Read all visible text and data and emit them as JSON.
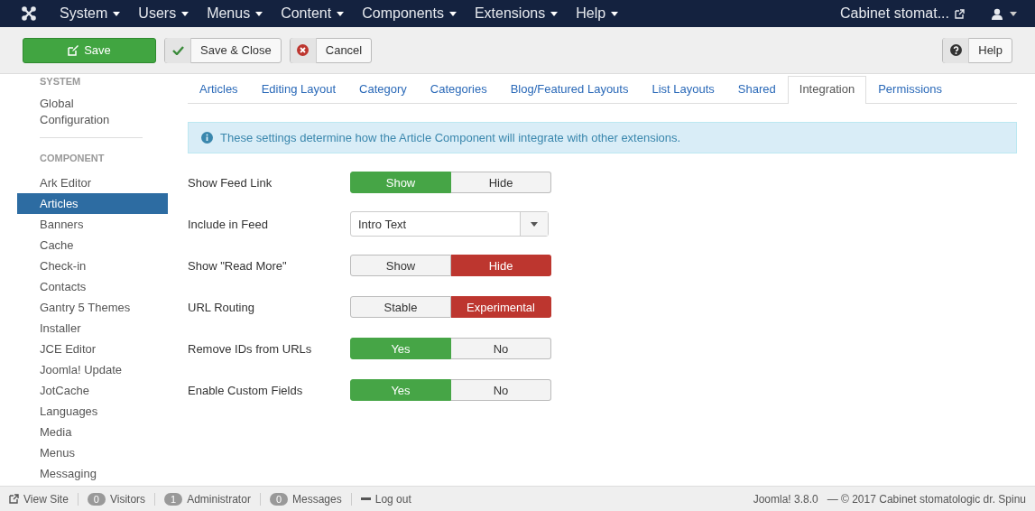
{
  "navbar": {
    "menus": [
      {
        "label": "System"
      },
      {
        "label": "Users"
      },
      {
        "label": "Menus"
      },
      {
        "label": "Content"
      },
      {
        "label": "Components"
      },
      {
        "label": "Extensions"
      },
      {
        "label": "Help"
      }
    ],
    "site_link": "Cabinet stomat..."
  },
  "toolbar": {
    "buttons": [
      {
        "label": "Save",
        "kind": "primary"
      },
      {
        "label": "Save & Close",
        "kind": "check"
      },
      {
        "label": "Cancel",
        "kind": "cancel"
      }
    ],
    "help": "Help"
  },
  "sidebar": {
    "sections": [
      {
        "heading": "SYSTEM",
        "items": [
          {
            "label": "Global Configuration",
            "selected": false
          }
        ]
      },
      {
        "heading": "COMPONENT",
        "items": [
          {
            "label": "Ark Editor",
            "selected": false
          },
          {
            "label": "Articles",
            "selected": true
          },
          {
            "label": "Banners",
            "selected": false
          },
          {
            "label": "Cache",
            "selected": false
          },
          {
            "label": "Check-in",
            "selected": false
          },
          {
            "label": "Contacts",
            "selected": false
          },
          {
            "label": "Gantry 5 Themes",
            "selected": false
          },
          {
            "label": "Installer",
            "selected": false
          },
          {
            "label": "JCE Editor",
            "selected": false
          },
          {
            "label": "Joomla! Update",
            "selected": false
          },
          {
            "label": "JotCache",
            "selected": false
          },
          {
            "label": "Languages",
            "selected": false
          },
          {
            "label": "Media",
            "selected": false
          },
          {
            "label": "Menus",
            "selected": false
          },
          {
            "label": "Messaging",
            "selected": false
          }
        ]
      }
    ]
  },
  "tabs": [
    {
      "label": "Articles",
      "selected": false
    },
    {
      "label": "Editing Layout",
      "selected": false
    },
    {
      "label": "Category",
      "selected": false
    },
    {
      "label": "Categories",
      "selected": false
    },
    {
      "label": "Blog/Featured Layouts",
      "selected": false
    },
    {
      "label": "List Layouts",
      "selected": false
    },
    {
      "label": "Shared",
      "selected": false
    },
    {
      "label": "Integration",
      "selected": true
    },
    {
      "label": "Permissions",
      "selected": false
    }
  ],
  "info": "These settings determine how the Article Component will integrate with other extensions.",
  "fields": [
    {
      "label": "Show Feed Link",
      "kind": "toggle",
      "options": [
        {
          "label": "Show",
          "selected": true,
          "color": "#46a546"
        },
        {
          "label": "Hide",
          "selected": false
        }
      ]
    },
    {
      "label": "Include in Feed",
      "kind": "select",
      "value": "Intro Text"
    },
    {
      "label": "Show \"Read More\"",
      "kind": "toggle",
      "options": [
        {
          "label": "Show",
          "selected": false
        },
        {
          "label": "Hide",
          "selected": true,
          "color": "#bd362f"
        }
      ]
    },
    {
      "label": "URL Routing",
      "kind": "toggle",
      "options": [
        {
          "label": "Stable",
          "selected": false
        },
        {
          "label": "Experimental",
          "selected": true,
          "color": "#bd362f"
        }
      ]
    },
    {
      "label": "Remove IDs from URLs",
      "kind": "toggle",
      "options": [
        {
          "label": "Yes",
          "selected": true,
          "color": "#46a546"
        },
        {
          "label": "No",
          "selected": false
        }
      ]
    },
    {
      "label": "Enable Custom Fields",
      "kind": "toggle",
      "options": [
        {
          "label": "Yes",
          "selected": true,
          "color": "#46a546"
        },
        {
          "label": "No",
          "selected": false
        }
      ]
    }
  ],
  "status_bar": {
    "view_site": "View Site",
    "counters": [
      {
        "count": "0",
        "label": "Visitors"
      },
      {
        "count": "1",
        "label": "Administrator"
      },
      {
        "count": "0",
        "label": "Messages"
      }
    ],
    "logout": "Log out",
    "version": "Joomla! 3.8.0",
    "copyright": "— © 2017 Cabinet stomatologic dr. Spinu"
  }
}
